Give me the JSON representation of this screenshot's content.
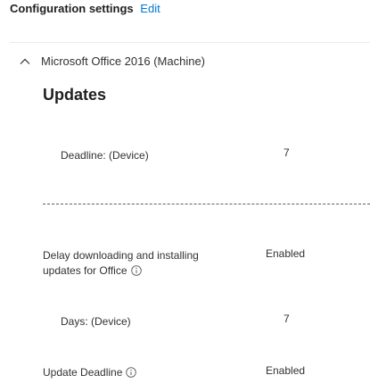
{
  "header": {
    "title": "Configuration settings",
    "edit_label": "Edit"
  },
  "section": {
    "title": "Microsoft Office 2016 (Machine)",
    "icon": "chevron-up-icon"
  },
  "group": {
    "title": "Updates"
  },
  "settings": [
    {
      "label": "Deadline: (Device)",
      "value": "7"
    },
    {
      "label_line1": "Delay downloading and installing",
      "label_line2": "updates for Office",
      "value": "Enabled",
      "info_icon": "info-icon"
    },
    {
      "label": "Days: (Device)",
      "value": "7"
    },
    {
      "label": "Update Deadline",
      "value": "Enabled",
      "info_icon": "info-icon"
    }
  ],
  "colors": {
    "link": "#0078d4",
    "text": "#323130",
    "divider": "#edebe9"
  }
}
